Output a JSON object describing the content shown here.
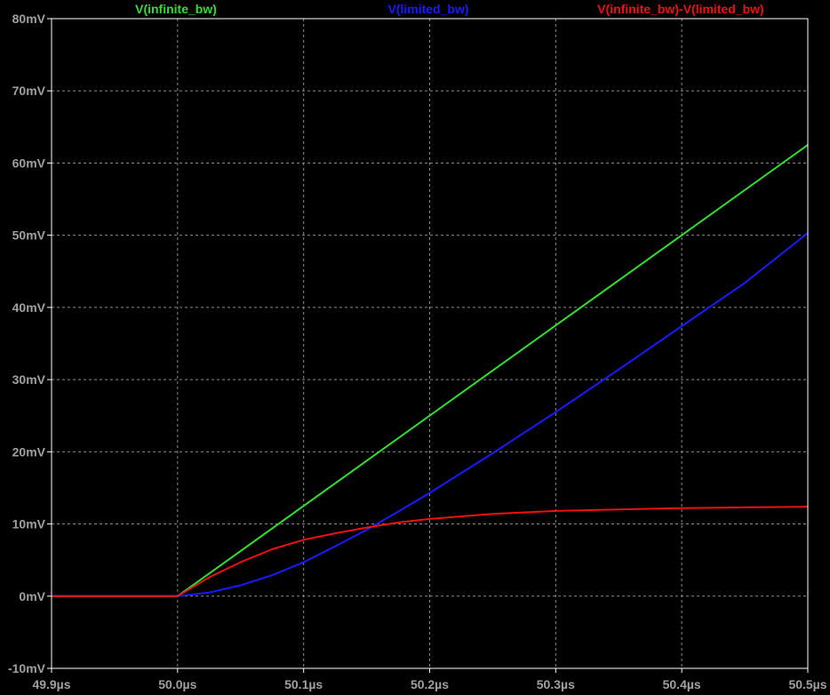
{
  "chart_data": {
    "type": "line",
    "title": "",
    "xlabel": "",
    "ylabel": "",
    "xlim": [
      49.9,
      50.5
    ],
    "ylim": [
      -10,
      80
    ],
    "grid": true,
    "legend_placement": "top",
    "x_ticks": [
      {
        "value": 49.9,
        "label": "49.9µs"
      },
      {
        "value": 50.0,
        "label": "50.0µs"
      },
      {
        "value": 50.1,
        "label": "50.1µs"
      },
      {
        "value": 50.2,
        "label": "50.2µs"
      },
      {
        "value": 50.3,
        "label": "50.3µs"
      },
      {
        "value": 50.4,
        "label": "50.4µs"
      },
      {
        "value": 50.5,
        "label": "50.5µs"
      }
    ],
    "y_ticks": [
      {
        "value": 80,
        "label": "80mV"
      },
      {
        "value": 70,
        "label": "70mV"
      },
      {
        "value": 60,
        "label": "60mV"
      },
      {
        "value": 50,
        "label": "50mV"
      },
      {
        "value": 40,
        "label": "40mV"
      },
      {
        "value": 30,
        "label": "30mV"
      },
      {
        "value": 20,
        "label": "20mV"
      },
      {
        "value": 10,
        "label": "10mV"
      },
      {
        "value": 0,
        "label": "0mV"
      },
      {
        "value": -10,
        "label": "-10mV"
      }
    ],
    "series": [
      {
        "name": "V(infinite_bw)",
        "color": "#33dd33",
        "x": [
          49.9,
          50.0,
          50.5
        ],
        "y": [
          0,
          0,
          62.5
        ]
      },
      {
        "name": "V(limited_bw)",
        "color": "#1a1aff",
        "x": [
          49.9,
          50.0,
          50.025,
          50.05,
          50.075,
          50.1,
          50.125,
          50.15,
          50.175,
          50.2,
          50.25,
          50.3,
          50.35,
          50.4,
          50.45,
          50.5
        ],
        "y": [
          0,
          0,
          0.5,
          1.5,
          2.9,
          4.7,
          6.9,
          9.2,
          11.7,
          14.3,
          19.8,
          25.5,
          31.4,
          37.4,
          43.4,
          50.3
        ]
      },
      {
        "name": "V(infinite_bw)-V(limited_bw)",
        "color": "#ee1111",
        "x": [
          49.9,
          50.0,
          50.025,
          50.05,
          50.075,
          50.1,
          50.125,
          50.15,
          50.175,
          50.2,
          50.25,
          50.3,
          50.35,
          50.4,
          50.45,
          50.5
        ],
        "y": [
          0,
          0,
          2.6,
          4.7,
          6.5,
          7.8,
          8.7,
          9.5,
          10.2,
          10.7,
          11.4,
          11.8,
          12.0,
          12.2,
          12.3,
          12.4
        ]
      }
    ]
  }
}
